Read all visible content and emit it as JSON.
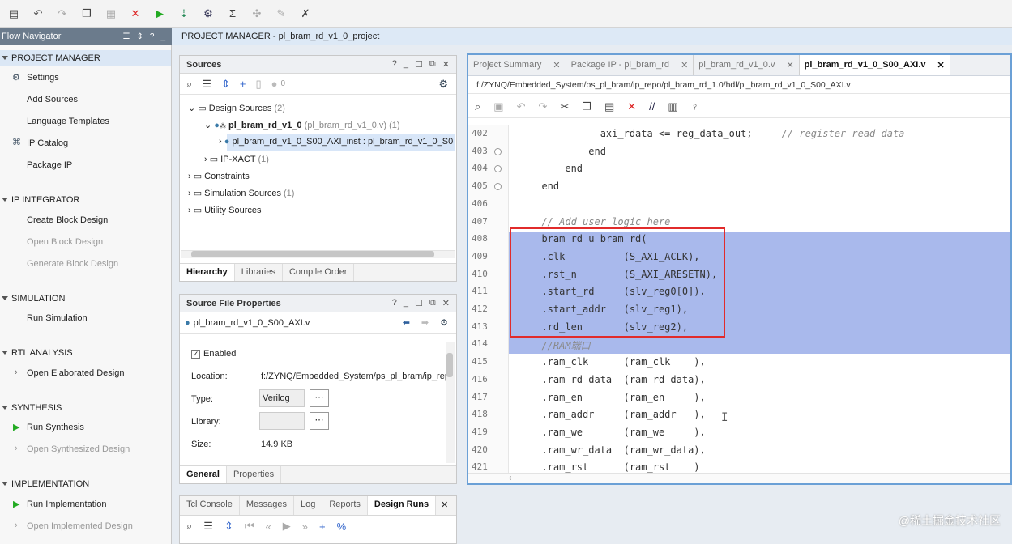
{
  "toolbar": {
    "icons": [
      "open-icon",
      "undo-icon",
      "redo-icon",
      "copy-icon",
      "paste-icon",
      "delete-icon",
      "run-icon",
      "program-icon",
      "settings-icon",
      "sigma-icon",
      "tool-icon",
      "pen-icon",
      "cross-tool-icon"
    ]
  },
  "flow_nav": {
    "title": "Flow Navigator",
    "sections": [
      {
        "label": "PROJECT MANAGER"
      },
      {
        "label": "IP INTEGRATOR"
      },
      {
        "label": "SIMULATION"
      },
      {
        "label": "RTL ANALYSIS"
      },
      {
        "label": "SYNTHESIS"
      },
      {
        "label": "IMPLEMENTATION"
      }
    ],
    "items": {
      "settings": "Settings",
      "add_sources": "Add Sources",
      "lang_templates": "Language Templates",
      "ip_catalog": "IP Catalog",
      "package_ip": "Package IP",
      "create_bd": "Create Block Design",
      "open_bd": "Open Block Design",
      "gen_bd": "Generate Block Design",
      "run_sim": "Run Simulation",
      "open_elab": "Open Elaborated Design",
      "run_synth": "Run Synthesis",
      "open_synth": "Open Synthesized Design",
      "run_impl": "Run Implementation",
      "open_impl": "Open Implemented Design"
    }
  },
  "pm_header": "PROJECT MANAGER - pl_bram_rd_v1_0_project",
  "sources": {
    "title": "Sources",
    "count": "0",
    "tree": {
      "design_sources": "Design Sources",
      "design_count": "(2)",
      "top": "pl_bram_rd_v1_0",
      "top_file": "(pl_bram_rd_v1_0.v) (1)",
      "inst": "pl_bram_rd_v1_0_S00_AXI_inst : pl_bram_rd_v1_0_S0",
      "ipxact": "IP-XACT",
      "ipxact_count": "(1)",
      "constraints": "Constraints",
      "sim_sources": "Simulation Sources",
      "sim_count": "(1)",
      "utility": "Utility Sources"
    },
    "tabs": [
      "Hierarchy",
      "Libraries",
      "Compile Order"
    ]
  },
  "props": {
    "title": "Source File Properties",
    "file": "pl_bram_rd_v1_0_S00_AXI.v",
    "enabled": "Enabled",
    "location_label": "Location:",
    "location": "f:/ZYNQ/Embedded_System/ps_pl_bram/ip_rep",
    "type_label": "Type:",
    "type": "Verilog",
    "library_label": "Library:",
    "size_label": "Size:",
    "size": "14.9 KB",
    "tabs": [
      "General",
      "Properties"
    ]
  },
  "editor": {
    "tabs": [
      "Project Summary",
      "Package IP - pl_bram_rd",
      "pl_bram_rd_v1_0.v",
      "pl_bram_rd_v1_0_S00_AXI.v"
    ],
    "path": "f:/ZYNQ/Embedded_System/ps_pl_bram/ip_repo/pl_bram_rd_1.0/hdl/pl_bram_rd_v1_0_S00_AXI.v",
    "lines": [
      {
        "n": "402",
        "code": "            axi_rdata <= reg_data_out;     ",
        "cm": "// register read data"
      },
      {
        "n": "403",
        "code": "          end",
        "cm": ""
      },
      {
        "n": "404",
        "code": "      end",
        "cm": ""
      },
      {
        "n": "405",
        "code": "  end",
        "cm": ""
      },
      {
        "n": "406",
        "code": "",
        "cm": ""
      },
      {
        "n": "407",
        "code": "  ",
        "cm": "// Add user logic here"
      },
      {
        "n": "408",
        "code": "  bram_rd u_bram_rd(",
        "cm": ""
      },
      {
        "n": "409",
        "code": "  .clk          (S_AXI_ACLK),",
        "cm": ""
      },
      {
        "n": "410",
        "code": "  .rst_n        (S_AXI_ARESETN),",
        "cm": ""
      },
      {
        "n": "411",
        "code": "  .start_rd     (slv_reg0[0]),",
        "cm": ""
      },
      {
        "n": "412",
        "code": "  .start_addr   (slv_reg1),",
        "cm": ""
      },
      {
        "n": "413",
        "code": "  .rd_len       (slv_reg2),",
        "cm": ""
      },
      {
        "n": "414",
        "code": "  ",
        "cm": "//RAM端口"
      },
      {
        "n": "415",
        "code": "  .ram_clk      (ram_clk    ),",
        "cm": ""
      },
      {
        "n": "416",
        "code": "  .ram_rd_data  (ram_rd_data),",
        "cm": ""
      },
      {
        "n": "417",
        "code": "  .ram_en       (ram_en     ),",
        "cm": ""
      },
      {
        "n": "418",
        "code": "  .ram_addr     (ram_addr   ),",
        "cm": ""
      },
      {
        "n": "419",
        "code": "  .ram_we       (ram_we     ),",
        "cm": ""
      },
      {
        "n": "420",
        "code": "  .ram_wr_data  (ram_wr_data),",
        "cm": ""
      },
      {
        "n": "421",
        "code": "  .ram_rst      (ram_rst    )",
        "cm": ""
      }
    ]
  },
  "bottom_tabs": [
    "Tcl Console",
    "Messages",
    "Log",
    "Reports",
    "Design Runs"
  ],
  "watermark": "@稀土掘金技术社区"
}
